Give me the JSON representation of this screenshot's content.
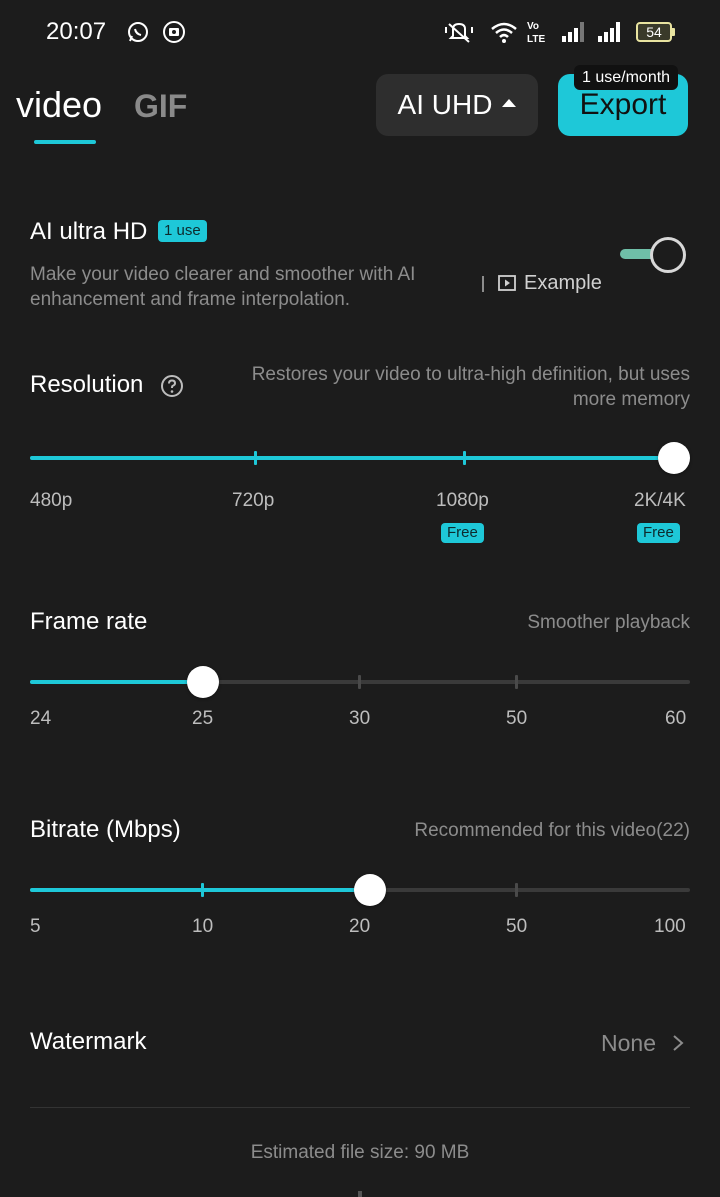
{
  "status_bar": {
    "time": "20:07",
    "battery": "54",
    "icons": [
      "whatsapp-icon",
      "media-icon",
      "mute-icon",
      "wifi-icon",
      "volte-icon",
      "signal-icon",
      "signal-icon",
      "battery-icon"
    ]
  },
  "header": {
    "tabs": [
      {
        "label": "video",
        "active": true
      },
      {
        "label": "GIF",
        "active": false
      }
    ],
    "quality_label": "AI UHD",
    "export_label": "Export",
    "usage_badge": "1 use/month"
  },
  "ai_uhd": {
    "title": "AI ultra HD",
    "badge": "1 use",
    "description": "Make your video clearer and smoother with AI enhancement and frame interpolation.",
    "example_label": "Example",
    "enabled": true
  },
  "resolution": {
    "title": "Resolution",
    "hint": "Restores your video to ultra-high definition, but uses more memory",
    "options": [
      "480p",
      "720p",
      "1080p",
      "2K/4K"
    ],
    "free_badge": "Free",
    "selected_index": 3
  },
  "frame_rate": {
    "title": "Frame rate",
    "hint": "Smoother playback",
    "options": [
      "24",
      "25",
      "30",
      "50",
      "60"
    ],
    "selected_index": 1
  },
  "bitrate": {
    "title": "Bitrate (Mbps)",
    "hint": "Recommended for this video(22)",
    "options": [
      "5",
      "10",
      "20",
      "50",
      "100"
    ],
    "selected_index": 2
  },
  "watermark": {
    "title": "Watermark",
    "value": "None"
  },
  "estimated_size": "Estimated file size: 90 MB",
  "colors": {
    "accent": "#1ec8d8",
    "background": "#1c1c1c"
  }
}
